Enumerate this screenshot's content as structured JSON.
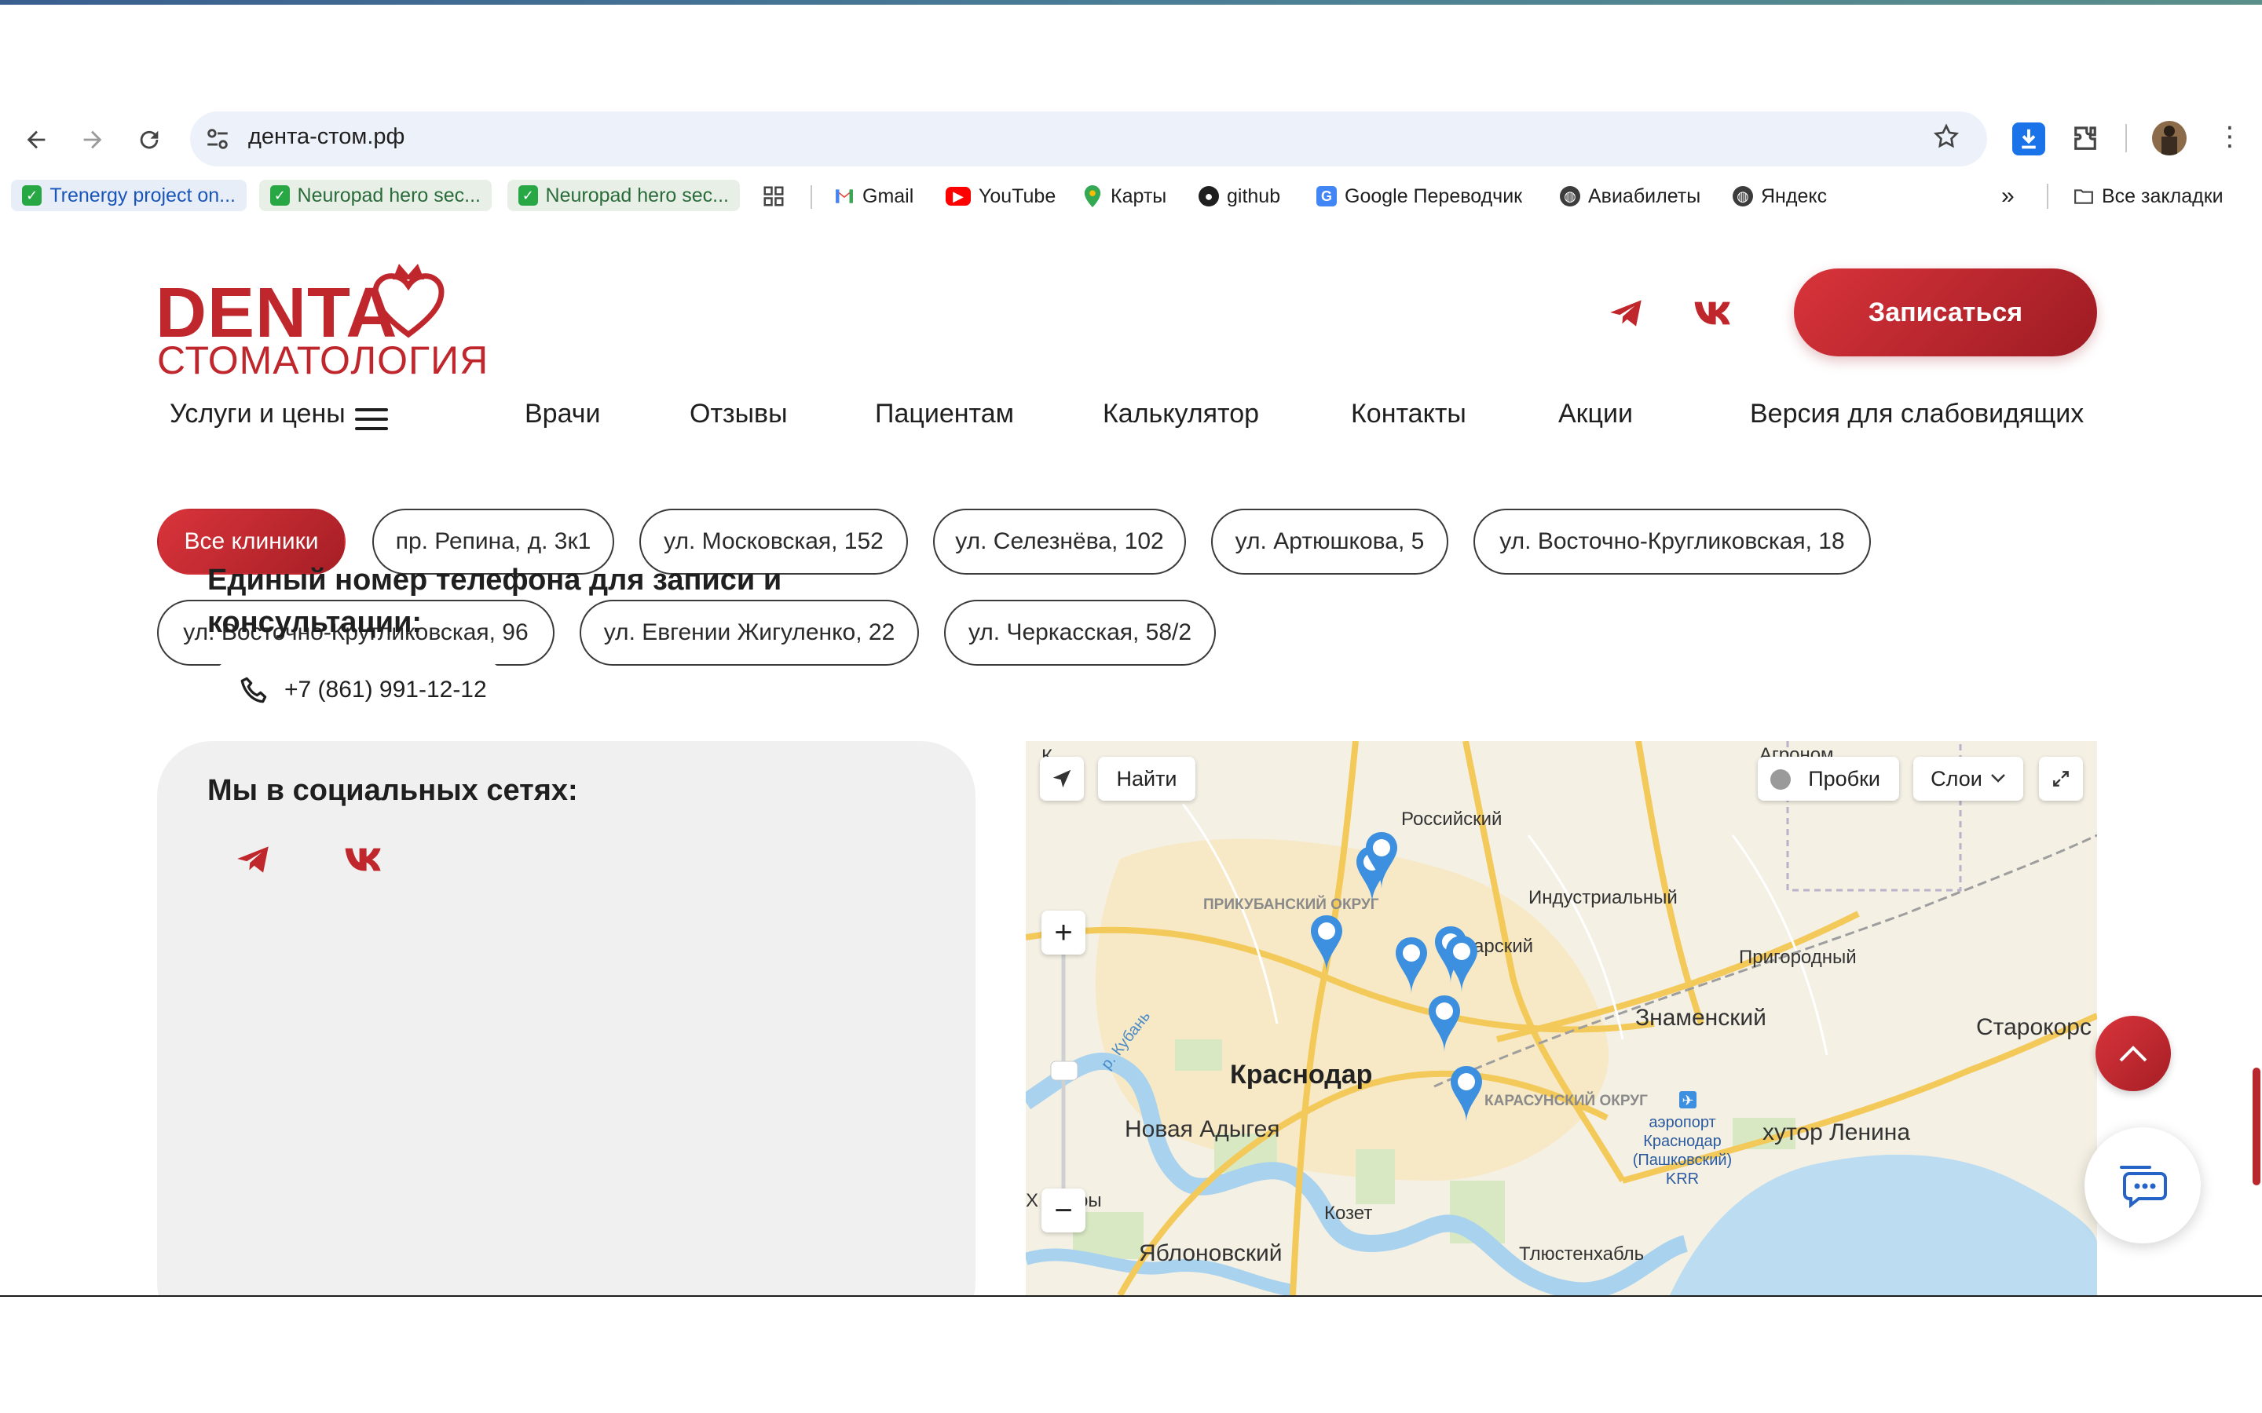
{
  "browser": {
    "url": "дента-стом.рф",
    "bookmarks": [
      {
        "label": "Trenergy project on..."
      },
      {
        "label": "Neuropad hero sec..."
      },
      {
        "label": "Neuropad hero sec..."
      },
      {
        "label": "Gmail"
      },
      {
        "label": "YouTube"
      },
      {
        "label": "Карты"
      },
      {
        "label": "github"
      },
      {
        "label": "Google Переводчик"
      },
      {
        "label": "Авиабилеты"
      },
      {
        "label": "Яндекс"
      }
    ],
    "more_label": "»",
    "all_bookmarks": "Все закладки"
  },
  "header": {
    "logo_main": "DENTA",
    "logo_sub": "СТОМАТОЛОГИЯ",
    "cta_label": "Записаться"
  },
  "menu": {
    "services": "Услуги и цены",
    "doctors": "Врачи",
    "reviews": "Отзывы",
    "patients": "Пациентам",
    "calculator": "Калькулятор",
    "contacts": "Контакты",
    "promos": "Акции",
    "accessible": "Версия для слабовидящих"
  },
  "clinics": {
    "chips": [
      "Все клиники",
      "пр. Репина, д. 3к1",
      "ул. Московская, 152",
      "ул. Селезнёва, 102",
      "ул. Артюшкова, 5",
      "ул. Восточно-Кругликовская, 18",
      "ул. Восточно-Кругликовская, 96",
      "ул. Евгении Жигуленко, 22",
      "ул. Черкасская, 58/2"
    ],
    "active_index": 0
  },
  "contact": {
    "title": "Единый номер телефона для записи и консультации:",
    "phone": "+7 (861) 991-12-12",
    "social_title": "Мы в социальных сетях:"
  },
  "map": {
    "find_label": "Найти",
    "traffic_label": "Пробки",
    "layers_label": "Слои",
    "labels": {
      "rossiyskiy": "Российский",
      "industrialny": "Индустриальный",
      "prikubansky": "ПРИКУБАНСКИЙ ОКРУГ",
      "tsentr_frag": "дарский",
      "prigorodny": "Пригородный",
      "znamensky": "Знаменский",
      "starokors": "Старокорс",
      "krasnodar": "Краснодар",
      "karasunsky": "КАРАСУНСКИЙ ОКРУГ",
      "airport": "аэропорт Краснодар (Пашковский) KRR",
      "novaya_adygeya": "Новая Адыгея",
      "khutor_lenina": "хутор Ленина",
      "kozet": "Козет",
      "yablonovsky": "Яблоновский",
      "tlyustenkhabl": "Тлюстенхабль",
      "kuban": "р. Кубань",
      "agronom": "Агроном",
      "k_frag": "К",
      "kh_frag": "Х",
      "ry_frag": "ры"
    }
  },
  "colors": {
    "brand_red": "#c0272d",
    "cta_gradient_start": "#d9343b",
    "cta_gradient_end": "#9d1b22",
    "card_bg": "#f0f0f0",
    "pin_blue": "#3d8fe0"
  }
}
